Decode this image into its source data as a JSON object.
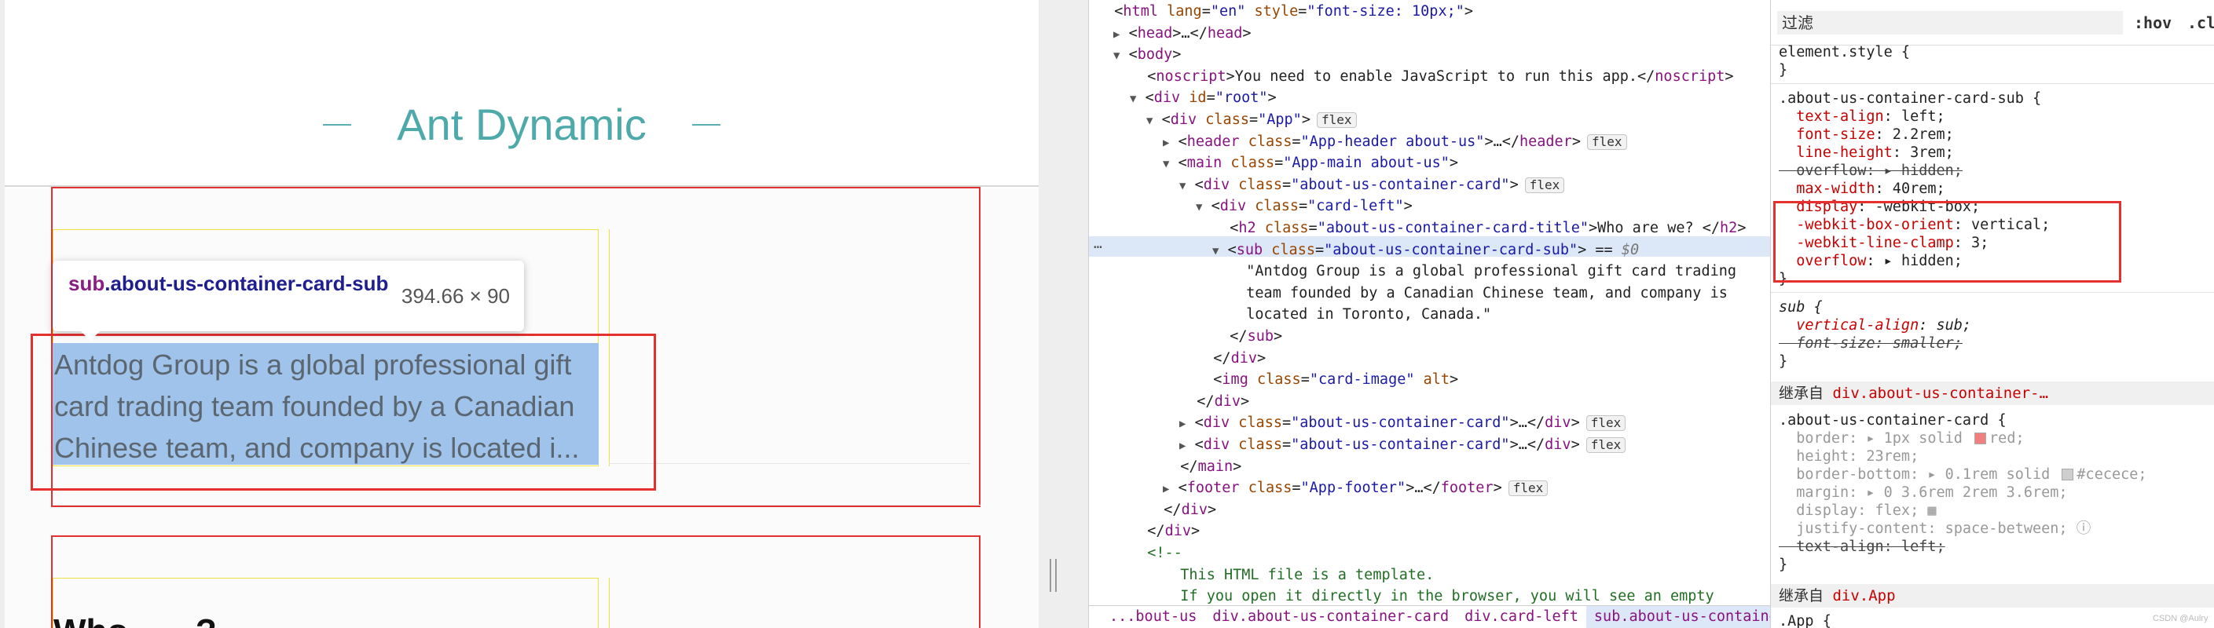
{
  "preview": {
    "brand_title": "Ant Dynamic",
    "card_lines": [
      "Antdog Group is a global professional gift",
      "card trading team founded by a Canadian",
      "Chinese team, and company is located i..."
    ],
    "tooltip": {
      "tag": "sub",
      "class": ".about-us-container-card-sub",
      "size": "394.66 × 90"
    },
    "bottom_heading": "Who ......?"
  },
  "elements": {
    "lines": [
      {
        "indent": 0,
        "tri": "",
        "html": "&lt;<span class='t-tag'>html</span> <span class='t-attr'>lang</span>=<span class='t-val'>\"en\"</span> <span class='t-attr'>style</span>=<span class='t-val'>\"font-size: 10px;\"</span>&gt;"
      },
      {
        "indent": 1,
        "tri": "▶",
        "html": "&lt;<span class='t-tag'>head</span>&gt;…&lt;/<span class='t-tag'>head</span>&gt;"
      },
      {
        "indent": 1,
        "tri": "▼",
        "html": "&lt;<span class='t-tag'>body</span>&gt;"
      },
      {
        "indent": 2,
        "tri": "",
        "html": "&lt;<span class='t-tag'>noscript</span>&gt;You need to enable JavaScript to run this app.&lt;/<span class='t-tag'>noscript</span>&gt;"
      },
      {
        "indent": 2,
        "tri": "▼",
        "html": "&lt;<span class='t-tag'>div</span> <span class='t-attr'>id</span>=<span class='t-val'>\"root\"</span>&gt;"
      },
      {
        "indent": 3,
        "tri": "▼",
        "html": "&lt;<span class='t-tag'>div</span> <span class='t-attr'>class</span>=<span class='t-val'>\"App\"</span>&gt;<span class='badge'>flex</span>"
      },
      {
        "indent": 4,
        "tri": "▶",
        "html": "&lt;<span class='t-tag'>header</span> <span class='t-attr'>class</span>=<span class='t-val'>\"App-header about-us\"</span>&gt;…&lt;/<span class='t-tag'>header</span>&gt;<span class='badge'>flex</span>"
      },
      {
        "indent": 4,
        "tri": "▼",
        "html": "&lt;<span class='t-tag'>main</span> <span class='t-attr'>class</span>=<span class='t-val'>\"App-main about-us\"</span>&gt;"
      },
      {
        "indent": 5,
        "tri": "▼",
        "html": "&lt;<span class='t-tag'>div</span> <span class='t-attr'>class</span>=<span class='t-val'>\"about-us-container-card\"</span>&gt;<span class='badge'>flex</span>"
      },
      {
        "indent": 6,
        "tri": "▼",
        "html": "&lt;<span class='t-tag'>div</span> <span class='t-attr'>class</span>=<span class='t-val'>\"card-left\"</span>&gt;"
      },
      {
        "indent": 7,
        "tri": "",
        "html": "&lt;<span class='t-tag'>h2</span> <span class='t-attr'>class</span>=<span class='t-val'>\"about-us-container-card-title\"</span>&gt;Who are we? &lt;/<span class='t-tag'>h2</span>&gt;"
      },
      {
        "indent": 7,
        "tri": "▼",
        "html": "&lt;<span class='t-tag'>sub</span> <span class='t-attr'>class</span>=<span class='t-val'>\"about-us-container-card-sub\"</span>&gt; == <span style='color:#777;font-style:italic'>$0</span>"
      },
      {
        "indent": 8,
        "tri": "",
        "html": "\"Antdog Group is a global professional gift card trading"
      },
      {
        "indent": 8,
        "tri": "",
        "html": "team founded by a Canadian Chinese team, and company is"
      },
      {
        "indent": 8,
        "tri": "",
        "html": "located in Toronto, Canada.\""
      },
      {
        "indent": 7,
        "tri": "",
        "html": "&lt;/<span class='t-tag'>sub</span>&gt;"
      },
      {
        "indent": 6,
        "tri": "",
        "html": "&lt;/<span class='t-tag'>div</span>&gt;"
      },
      {
        "indent": 6,
        "tri": "",
        "html": "&lt;<span class='t-tag'>img</span> <span class='t-attr'>class</span>=<span class='t-val'>\"card-image\"</span> <span class='t-attr'>alt</span>&gt;"
      },
      {
        "indent": 5,
        "tri": "",
        "html": "&lt;/<span class='t-tag'>div</span>&gt;"
      },
      {
        "indent": 5,
        "tri": "▶",
        "html": "&lt;<span class='t-tag'>div</span> <span class='t-attr'>class</span>=<span class='t-val'>\"about-us-container-card\"</span>&gt;…&lt;/<span class='t-tag'>div</span>&gt;<span class='badge'>flex</span>"
      },
      {
        "indent": 5,
        "tri": "▶",
        "html": "&lt;<span class='t-tag'>div</span> <span class='t-attr'>class</span>=<span class='t-val'>\"about-us-container-card\"</span>&gt;…&lt;/<span class='t-tag'>div</span>&gt;<span class='badge'>flex</span>"
      },
      {
        "indent": 4,
        "tri": "",
        "html": "&lt;/<span class='t-tag'>main</span>&gt;"
      },
      {
        "indent": 4,
        "tri": "▶",
        "html": "&lt;<span class='t-tag'>footer</span> <span class='t-attr'>class</span>=<span class='t-val'>\"App-footer\"</span>&gt;…&lt;/<span class='t-tag'>footer</span>&gt;<span class='badge'>flex</span>"
      },
      {
        "indent": 3,
        "tri": "",
        "html": "&lt;/<span class='t-tag'>div</span>&gt;"
      },
      {
        "indent": 2,
        "tri": "",
        "html": "&lt;/<span class='t-tag'>div</span>&gt;"
      },
      {
        "indent": 2,
        "tri": "",
        "html": "<span class='t-com'>&lt;!--</span>"
      },
      {
        "indent": 4,
        "tri": "",
        "html": "<span class='t-com'>This HTML file is a template.</span>"
      },
      {
        "indent": 4,
        "tri": "",
        "html": "<span class='t-com'>If you open it directly in the browser, you will see an empty</span>"
      }
    ],
    "breadcrumbs": [
      "...bout-us",
      "div.about-us-container-card",
      "div.card-left",
      "sub.about-us-container-card-sub",
      "..."
    ]
  },
  "styles": {
    "filter_placeholder": "过滤",
    "hov": ":hov",
    "cls": ".cls",
    "inherit_1_label": "继承自",
    "inherit_1_sel": "div.about-us-container-…",
    "inherit_2_label": "继承自",
    "inherit_2_sel": "div.App",
    "watermark": "CSDN @Aulry"
  },
  "colors": {
    "brand": "#4da9aa",
    "outline": "#e03030",
    "highlight": "#9fc3ea",
    "tag": "#881280",
    "attr": "#994500",
    "value": "#1a1aa6",
    "prop": "#c80000"
  }
}
